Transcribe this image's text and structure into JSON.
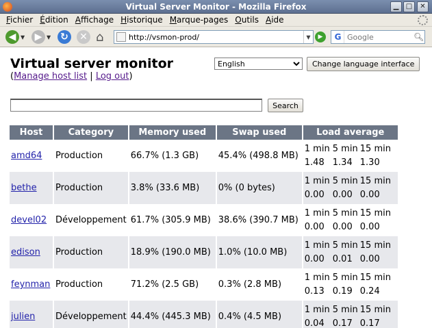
{
  "window": {
    "title": "Virtual Server Monitor - Mozilla Firefox"
  },
  "menu": [
    "Fichier",
    "Édition",
    "Affichage",
    "Historique",
    "Marque-pages",
    "Outils",
    "Aide"
  ],
  "toolbar": {
    "url": "http://vsmon-prod/",
    "search_placeholder": "Google",
    "search_engine_icon": "G"
  },
  "page": {
    "title": "Virtual server monitor",
    "manage_link": "Manage host list",
    "separator": "|",
    "logout_link": "Log out",
    "paren_open": "(",
    "paren_close": ")",
    "language": "English",
    "change_language_button": "Change language interface",
    "search_value": "",
    "search_button": "Search"
  },
  "table": {
    "headers": [
      "Host",
      "Category",
      "Memory used",
      "Swap used",
      "Load average"
    ],
    "load_labels": [
      "1 min",
      "5 min",
      "15 min"
    ],
    "rows": [
      {
        "host": "amd64",
        "category": "Production",
        "memory": "66.7% (1.3 GB)",
        "swap": "45.4% (498.8 MB)",
        "load": [
          "1.48",
          "1.34",
          "1.30"
        ]
      },
      {
        "host": "bethe",
        "category": "Production",
        "memory": "3.8% (33.6 MB)",
        "swap": "0% (0 bytes)",
        "load": [
          "0.00",
          "0.00",
          "0.00"
        ]
      },
      {
        "host": "devel02",
        "category": "Développement",
        "memory": "61.7% (305.9 MB)",
        "swap": "38.6% (390.7 MB)",
        "load": [
          "0.00",
          "0.00",
          "0.00"
        ]
      },
      {
        "host": "edison",
        "category": "Production",
        "memory": "18.9% (190.0 MB)",
        "swap": "1.0% (10.0 MB)",
        "load": [
          "0.00",
          "0.01",
          "0.00"
        ]
      },
      {
        "host": "feynman",
        "category": "Production",
        "memory": "71.2% (2.5 GB)",
        "swap": "0.3% (2.8 MB)",
        "load": [
          "0.13",
          "0.19",
          "0.24"
        ]
      },
      {
        "host": "julien",
        "category": "Développement",
        "memory": "44.4% (445.3 MB)",
        "swap": "0.4% (4.5 MB)",
        "load": [
          "0.04",
          "0.17",
          "0.17"
        ]
      }
    ]
  },
  "colors": {
    "header_bg": "#6b7585",
    "alt_row_bg": "#e7e8ec",
    "link": "#2222aa"
  }
}
